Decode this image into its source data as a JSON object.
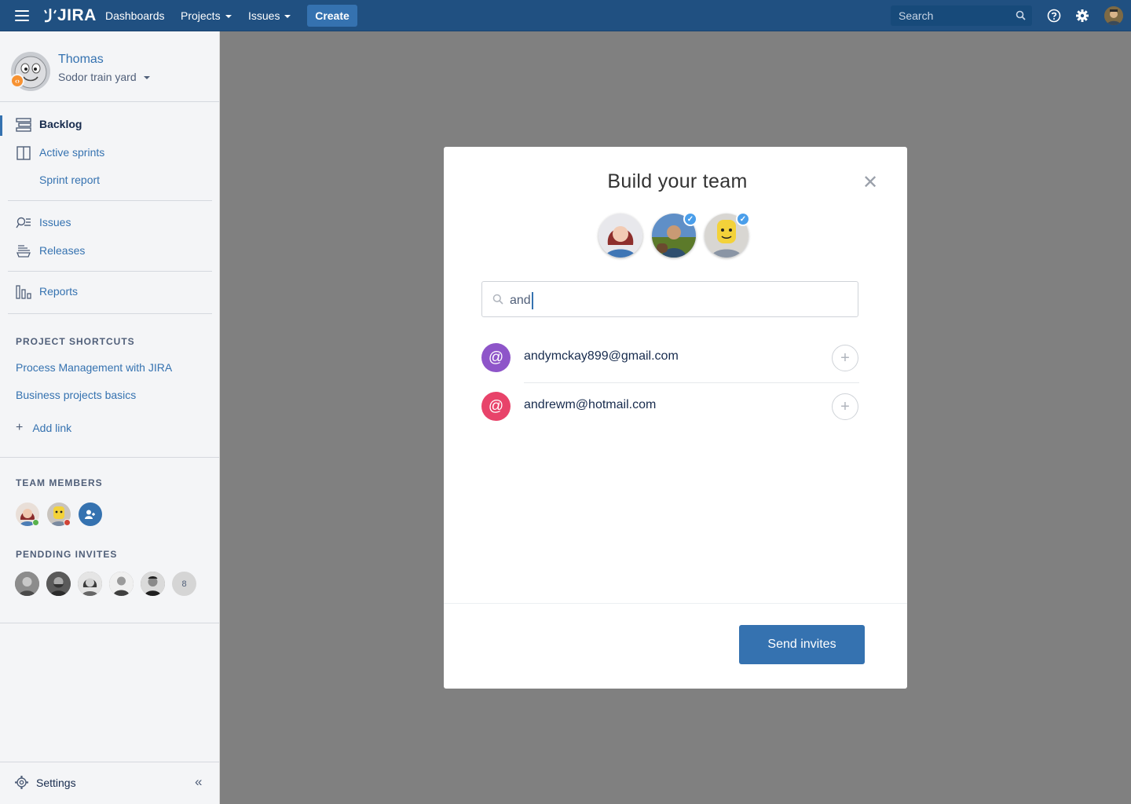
{
  "topnav": {
    "logo_text": "JIRA",
    "links": [
      {
        "label": "Dashboards",
        "dropdown": false
      },
      {
        "label": "Projects",
        "dropdown": true
      },
      {
        "label": "Issues",
        "dropdown": true
      }
    ],
    "create_label": "Create",
    "search_placeholder": "Search",
    "icons": [
      "menu-icon",
      "help-icon",
      "gear-icon",
      "user-avatar"
    ]
  },
  "sidebar": {
    "project": {
      "name": "Thomas",
      "subtitle": "Sodor train yard"
    },
    "nav": [
      {
        "label": "Backlog",
        "icon": "backlog-icon",
        "active": true
      },
      {
        "label": "Active sprints",
        "icon": "board-icon",
        "active": false
      },
      {
        "label": "Sprint report",
        "icon": "",
        "active": false
      },
      {
        "label": "Issues",
        "icon": "issues-icon",
        "active": false
      },
      {
        "label": "Releases",
        "icon": "releases-icon",
        "active": false
      },
      {
        "label": "Reports",
        "icon": "reports-icon",
        "active": false
      }
    ],
    "shortcuts_heading": "PROJECT SHORTCUTS",
    "shortcuts": [
      "Process Management with JIRA",
      "Business projects basics"
    ],
    "add_link_label": "Add link",
    "team_heading": "TEAM MEMBERS",
    "invites_heading": "PENDDING INVITES",
    "invites_more_count": "8",
    "settings_label": "Settings"
  },
  "modal": {
    "title": "Build your team",
    "search_value": "and",
    "results": [
      {
        "email": "andymckay899@gmail.com",
        "color": "#8e55c9"
      },
      {
        "email": "andrewm@hotmail.com",
        "color": "#e8436a"
      }
    ],
    "send_label": "Send invites"
  },
  "colors": {
    "header": "#205081",
    "accent": "#3572b0",
    "overlay": "#808080"
  }
}
